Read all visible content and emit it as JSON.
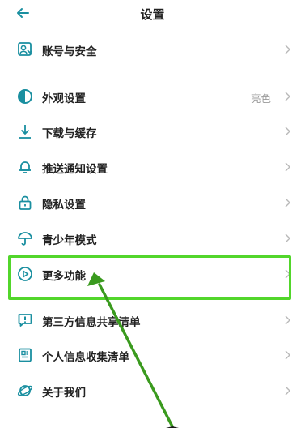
{
  "header": {
    "title": "设置"
  },
  "menu": {
    "items": [
      {
        "label": "账号与安全",
        "value": ""
      },
      {
        "label": "外观设置",
        "value": "亮色"
      },
      {
        "label": "下载与缓存",
        "value": ""
      },
      {
        "label": "推送通知设置",
        "value": ""
      },
      {
        "label": "隐私设置",
        "value": ""
      },
      {
        "label": "青少年模式",
        "value": ""
      },
      {
        "label": "更多功能",
        "value": ""
      },
      {
        "label": "第三方信息共享清单",
        "value": ""
      },
      {
        "label": "个人信息收集清单",
        "value": ""
      },
      {
        "label": "关于我们",
        "value": ""
      }
    ]
  },
  "colors": {
    "accent": "#1a8fa0",
    "highlight": "#52d62b",
    "annotation_arrow": "#3a9a1e"
  }
}
